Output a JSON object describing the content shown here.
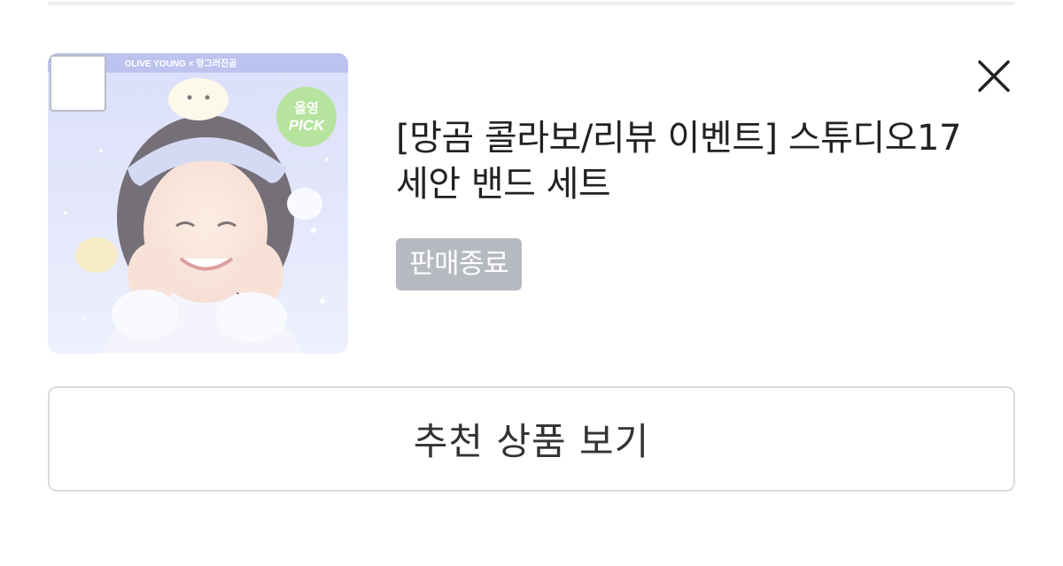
{
  "product": {
    "title": "[망곰 콜라보/리뷰 이벤트] 스튜디오17 세안 밴드 세트",
    "status_badge": "판매종료",
    "image": {
      "banner_text": "OLIVE YOUNG × 망그러진곰",
      "pick_badge_line1": "올영",
      "pick_badge_line2": "PICK"
    }
  },
  "actions": {
    "close_label": "×",
    "recommend_label": "추천 상품 보기"
  },
  "colors": {
    "badge_bg": "#b6b9c0",
    "pick_badge": "#8fd66a",
    "thumb_bg": "#dfe4fb"
  }
}
